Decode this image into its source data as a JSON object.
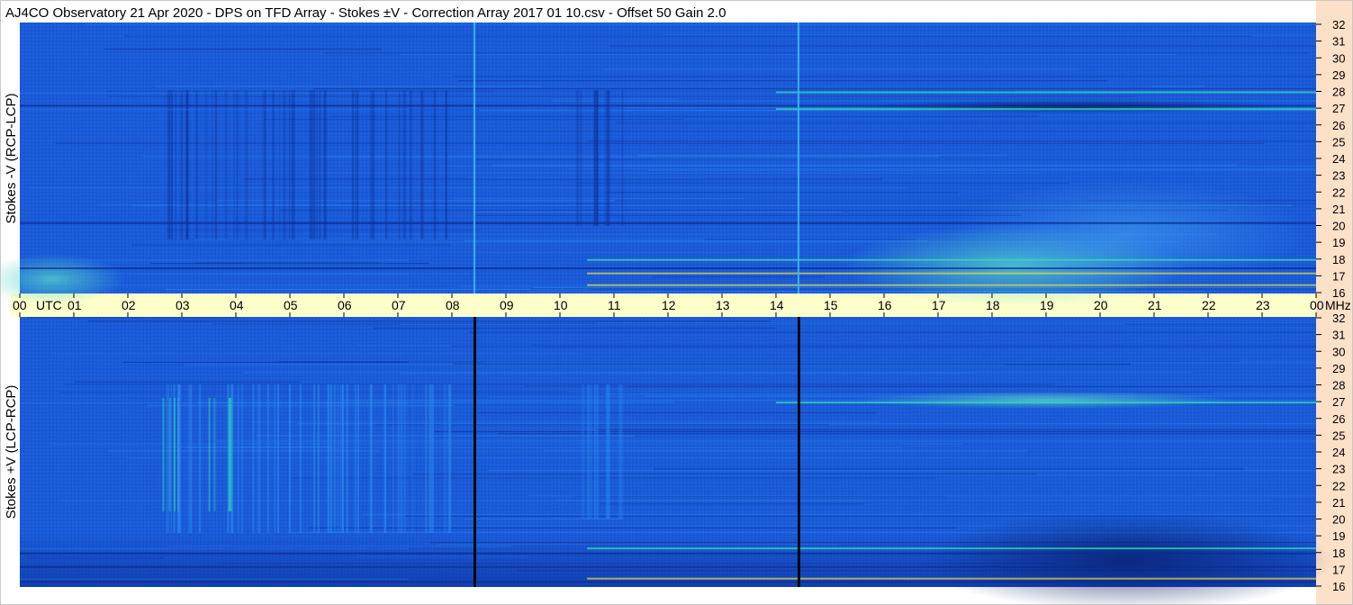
{
  "title": "AJ4CO Observatory  21 Apr 2020  -  DPS on TFD Array  -  Stokes ±V  -  Correction Array 2017 01 10.csv  -  Offset 50  Gain 2.0",
  "colors": {
    "background": "#ffffff",
    "time_axis_band": "#ffffcc",
    "freq_axis_band": "#fde0c8",
    "spectrogram_base": "#1a5ad8",
    "spectrogram_dark": "#0a2a90",
    "spectrogram_light": "#2a8af0",
    "spectrogram_hot": "#30e0b0",
    "spectrogram_cyan_line": "#38b8f0",
    "spectrogram_black_line": "#000000"
  },
  "chart_data": {
    "type": "heatmap",
    "time_axis": {
      "unit_label": "UTC",
      "tick_labels": [
        "00",
        "01",
        "02",
        "03",
        "04",
        "05",
        "06",
        "07",
        "08",
        "09",
        "10",
        "11",
        "12",
        "13",
        "14",
        "15",
        "16",
        "17",
        "18",
        "19",
        "20",
        "21",
        "22",
        "23",
        "00"
      ],
      "range_hours": [
        0,
        24
      ]
    },
    "freq_axis": {
      "unit_label": "MHz",
      "tick_labels": [
        "32",
        "31",
        "30",
        "29",
        "28",
        "27",
        "26",
        "25",
        "24",
        "23",
        "22",
        "21",
        "20",
        "19",
        "18",
        "17",
        "16"
      ],
      "range_mhz": [
        16,
        32
      ]
    },
    "panels": [
      {
        "ylabel": "Stokes -V (RCP-LCP)",
        "vertical_line_hours": [
          8.4,
          14.4
        ],
        "vertical_line_color": "cyan",
        "bright_band_mhz": [
          16.5,
          17.2,
          18,
          27,
          28
        ],
        "dark_band_mhz": [
          17.5,
          20.2,
          27.2
        ]
      },
      {
        "ylabel": "Stokes +V (LCP-RCP)",
        "vertical_line_hours": [
          8.4,
          14.4
        ],
        "vertical_line_color": "black",
        "bright_band_mhz": [
          16.5,
          18.3,
          27
        ],
        "dark_band_mhz": [
          16.3,
          17.2,
          18
        ]
      }
    ]
  }
}
